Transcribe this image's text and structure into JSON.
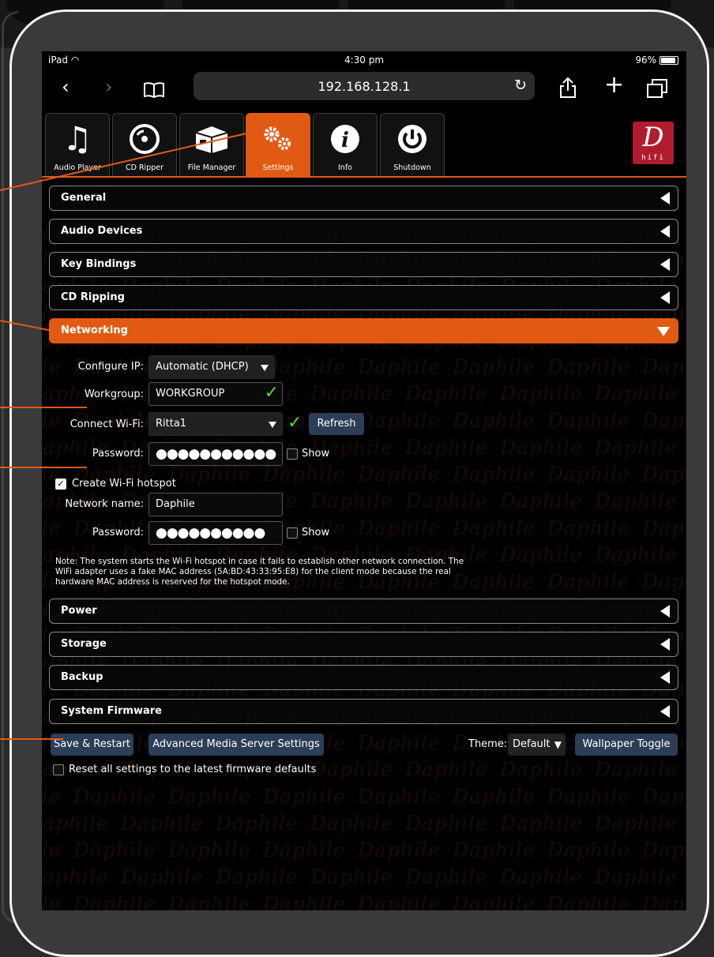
{
  "status_bar": {
    "device": "iPad",
    "time": "4:30 pm",
    "battery": "96%"
  },
  "browser": {
    "url": "192.168.128.1"
  },
  "tabs": [
    {
      "label": "Audio Player",
      "icon": "music-note-icon",
      "active": false
    },
    {
      "label": "CD Ripper",
      "icon": "disc-icon",
      "active": false
    },
    {
      "label": "File Manager",
      "icon": "box-icon",
      "active": false
    },
    {
      "label": "Settings",
      "icon": "gears-icon",
      "active": true
    },
    {
      "label": "Info",
      "icon": "info-icon",
      "active": false
    },
    {
      "label": "Shutdown",
      "icon": "power-icon",
      "active": false
    }
  ],
  "logo": {
    "letter": "D",
    "sub": "hifi"
  },
  "sections_top": [
    "General",
    "Audio Devices",
    "Key Bindings",
    "CD Ripping",
    "Networking"
  ],
  "networking": {
    "configure_ip_label": "Configure IP:",
    "configure_ip_value": "Automatic (DHCP)",
    "workgroup_label": "Workgroup:",
    "workgroup_value": "WORKGROUP",
    "wifi_label": "Connect Wi-Fi:",
    "wifi_value": "Ritta1",
    "refresh_label": "Refresh",
    "password_label": "Password:",
    "password_value": "●●●●●●●●●●●",
    "show_label": "Show",
    "hotspot_label": "Create Wi-Fi hotspot",
    "hotspot_checked": true,
    "network_name_label": "Network name:",
    "network_name_value": "Daphile",
    "hotspot_password_label": "Password:",
    "hotspot_password_value": "●●●●●●●●●●",
    "hotspot_show_label": "Show",
    "note": "Note: The system starts the Wi-Fi hotspot in case it fails to establish other network connection. The WiFi adapter uses a fake MAC address (5A:BD:43:33:95:E8) for the client mode because the real hardware MAC address is reserved for the hotspot mode."
  },
  "sections_bottom": [
    "Power",
    "Storage",
    "Backup",
    "System Firmware"
  ],
  "footer": {
    "save_label": "Save & Restart",
    "advanced_label": "Advanced Media Server Settings",
    "theme_label": "Theme:",
    "theme_value": "Default",
    "wallpaper_label": "Wallpaper Toggle",
    "reset_label": "Reset all settings to the latest firmware defaults"
  },
  "watermark": "Daphile",
  "colors": {
    "accent": "#e05a14",
    "button": "#2c3e57",
    "check": "#5fd12e",
    "logo": "#b01c2e"
  }
}
